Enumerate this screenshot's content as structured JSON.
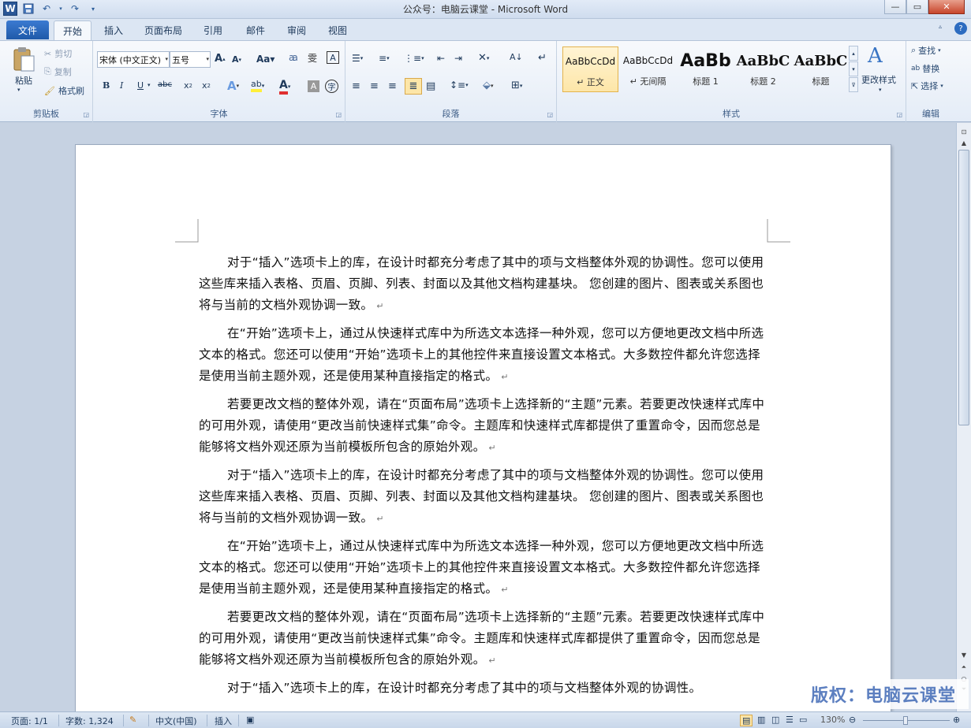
{
  "window": {
    "title": "公众号：电脑云课堂 - Microsoft Word"
  },
  "tabs": {
    "file": "文件",
    "items": [
      "开始",
      "插入",
      "页面布局",
      "引用",
      "邮件",
      "审阅",
      "视图"
    ]
  },
  "clipboard": {
    "paste": "粘贴",
    "cut": "剪切",
    "copy": "复制",
    "format_painter": "格式刷",
    "label": "剪贴板"
  },
  "font": {
    "family": "宋体 (中文正文)",
    "size": "五号",
    "label": "字体"
  },
  "paragraph": {
    "label": "段落"
  },
  "styles": {
    "label": "样式",
    "items": [
      {
        "sample": "AaBbCcDd",
        "name": "↵ 正文"
      },
      {
        "sample": "AaBbCcDd",
        "name": "↵ 无间隔"
      },
      {
        "sample": "AaBb",
        "name": "标题 1"
      },
      {
        "sample": "AaBbC",
        "name": "标题 2"
      },
      {
        "sample": "AaBbC",
        "name": "标题"
      }
    ],
    "change_styles": "更改样式"
  },
  "editing": {
    "find": "查找",
    "replace": "替换",
    "select": "选择",
    "label": "编辑"
  },
  "document": {
    "paragraphs": [
      "对于“插入”选项卡上的库，在设计时都充分考虑了其中的项与文档整体外观的协调性。您可以使用这些库来插入表格、页眉、页脚、列表、封面以及其他文档构建基块。 您创建的图片、图表或关系图也将与当前的文档外观协调一致。",
      "在“开始”选项卡上，通过从快速样式库中为所选文本选择一种外观，您可以方便地更改文档中所选文本的格式。您还可以使用“开始”选项卡上的其他控件来直接设置文本格式。大多数控件都允许您选择是使用当前主题外观，还是使用某种直接指定的格式。",
      "若要更改文档的整体外观，请在“页面布局”选项卡上选择新的“主题”元素。若要更改快速样式库中的可用外观，请使用“更改当前快速样式集”命令。主题库和快速样式库都提供了重置命令，因而您总是能够将文档外观还原为当前模板所包含的原始外观。",
      "对于“插入”选项卡上的库，在设计时都充分考虑了其中的项与文档整体外观的协调性。您可以使用这些库来插入表格、页眉、页脚、列表、封面以及其他文档构建基块。 您创建的图片、图表或关系图也将与当前的文档外观协调一致。",
      "在“开始”选项卡上，通过从快速样式库中为所选文本选择一种外观，您可以方便地更改文档中所选文本的格式。您还可以使用“开始”选项卡上的其他控件来直接设置文本格式。大多数控件都允许您选择是使用当前主题外观，还是使用某种直接指定的格式。",
      "若要更改文档的整体外观，请在“页面布局”选项卡上选择新的“主题”元素。若要更改快速样式库中的可用外观，请使用“更改当前快速样式集”命令。主题库和快速样式库都提供了重置命令，因而您总是能够将文档外观还原为当前模板所包含的原始外观。",
      "对于“插入”选项卡上的库，在设计时都充分考虑了其中的项与文档整体外观的协调性。"
    ],
    "paragraph_mark": "↵"
  },
  "status": {
    "page": "页面: 1/1",
    "words": "字数: 1,324",
    "language": "中文(中国)",
    "mode": "插入",
    "zoom": "130%"
  },
  "watermark": "版权：电脑云课堂",
  "colors": {
    "accent": "#2b5797",
    "ribbon": "#e4ecf7",
    "selected_style": "#fde6a8"
  }
}
